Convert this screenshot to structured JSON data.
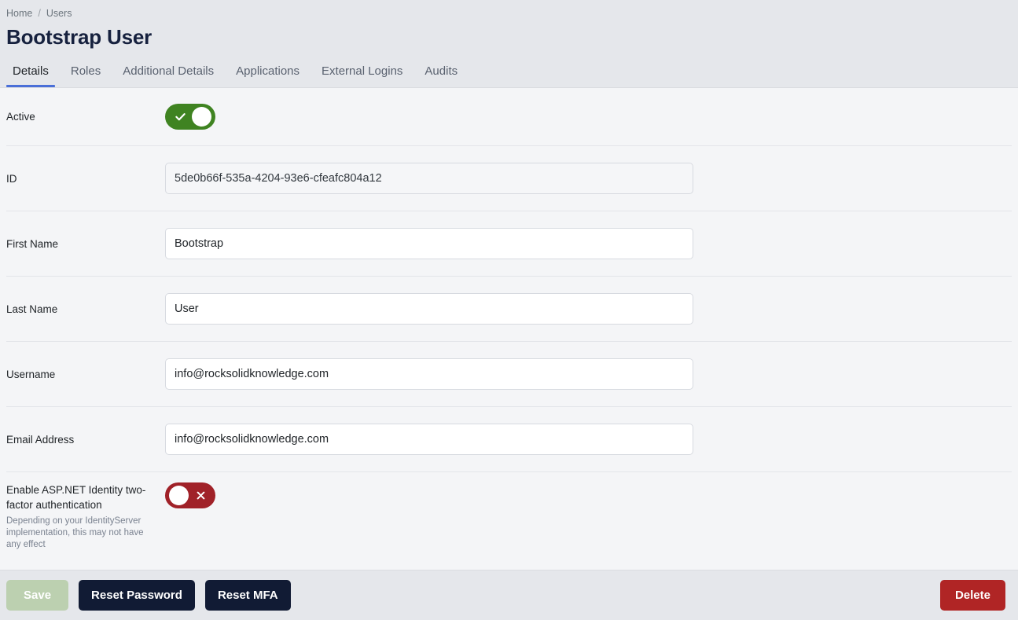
{
  "breadcrumb": {
    "items": [
      {
        "label": "Home"
      },
      {
        "label": "Users"
      }
    ],
    "separator": "/"
  },
  "header": {
    "title": "Bootstrap User"
  },
  "tabs": [
    {
      "label": "Details",
      "active": true
    },
    {
      "label": "Roles",
      "active": false
    },
    {
      "label": "Additional Details",
      "active": false
    },
    {
      "label": "Applications",
      "active": false
    },
    {
      "label": "External Logins",
      "active": false
    },
    {
      "label": "Audits",
      "active": false
    }
  ],
  "form": {
    "active": {
      "label": "Active",
      "toggle_state": "on",
      "toggle_icon": "check-icon"
    },
    "id": {
      "label": "ID",
      "value": "5de0b66f-535a-4204-93e6-cfeafc804a12",
      "readonly": true
    },
    "first_name": {
      "label": "First Name",
      "value": "Bootstrap"
    },
    "last_name": {
      "label": "Last Name",
      "value": "User"
    },
    "username": {
      "label": "Username",
      "value": "info@rocksolidknowledge.com"
    },
    "email": {
      "label": "Email Address",
      "value": "info@rocksolidknowledge.com"
    },
    "mfa": {
      "label": "Enable ASP.NET Identity two-factor authentication",
      "help": "Depending on your IdentityServer implementation, this may not have any effect",
      "toggle_state": "off",
      "toggle_icon": "cross-icon"
    }
  },
  "footer": {
    "save_label": "Save",
    "reset_password_label": "Reset Password",
    "reset_mfa_label": "Reset MFA",
    "delete_label": "Delete"
  },
  "colors": {
    "accent_tab": "#4a6fd8",
    "toggle_on": "#3f8321",
    "toggle_off": "#a02128",
    "button_dark": "#111b34",
    "button_danger": "#b02525",
    "button_save_disabled": "#bcd0b0",
    "header_bg": "#e5e7eb",
    "content_bg": "#f4f5f7"
  }
}
